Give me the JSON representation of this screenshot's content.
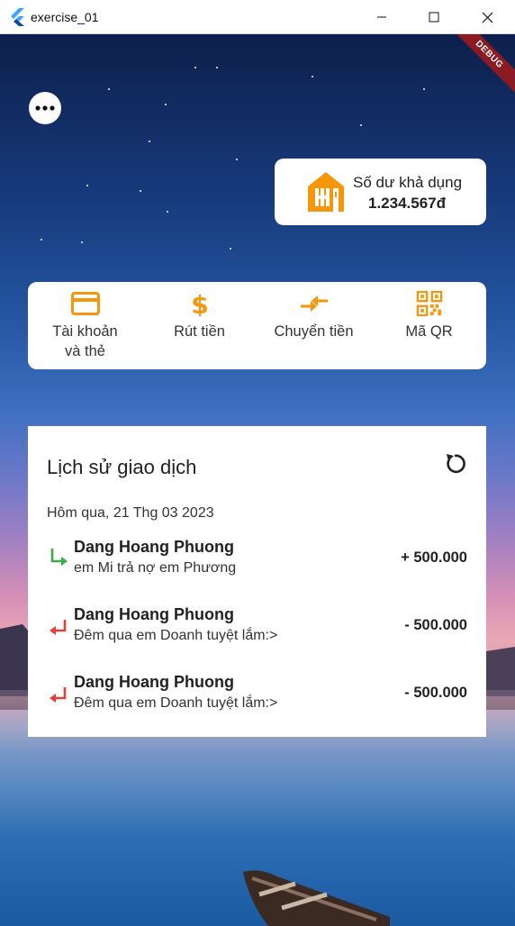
{
  "window": {
    "title": "exercise_01"
  },
  "app": {
    "debug_banner": "DEBUG",
    "balance": {
      "label": "Số dư khả dụng",
      "value": "1.234.567đ"
    },
    "actions": [
      {
        "label": "Tài khoản\nvà thẻ",
        "icon": "credit-card-icon"
      },
      {
        "label": "Rút tiền",
        "icon": "dollar-icon"
      },
      {
        "label": "Chuyển tiền",
        "icon": "transfer-arrows-icon"
      },
      {
        "label": "Mã QR",
        "icon": "qr-code-icon"
      }
    ],
    "history": {
      "title": "Lịch sử giao dịch",
      "date": "Hôm qua, 21 Thg 03 2023",
      "transactions": [
        {
          "name": "Dang Hoang Phuong",
          "note": "em Mi trả nợ em Phương",
          "amount": "+ 500.000",
          "direction": "in"
        },
        {
          "name": "Dang Hoang Phuong",
          "note": "Đêm qua em Doanh tuyệt lắm:>",
          "amount": "- 500.000",
          "direction": "out"
        },
        {
          "name": "Dang Hoang Phuong",
          "note": "Đêm qua em Doanh tuyệt lắm:>",
          "amount": "- 500.000",
          "direction": "out"
        }
      ]
    }
  },
  "colors": {
    "accent": "#f5960b",
    "incoming": "#3aaa4a",
    "outgoing": "#e0413a",
    "debug": "#8b1a22"
  }
}
